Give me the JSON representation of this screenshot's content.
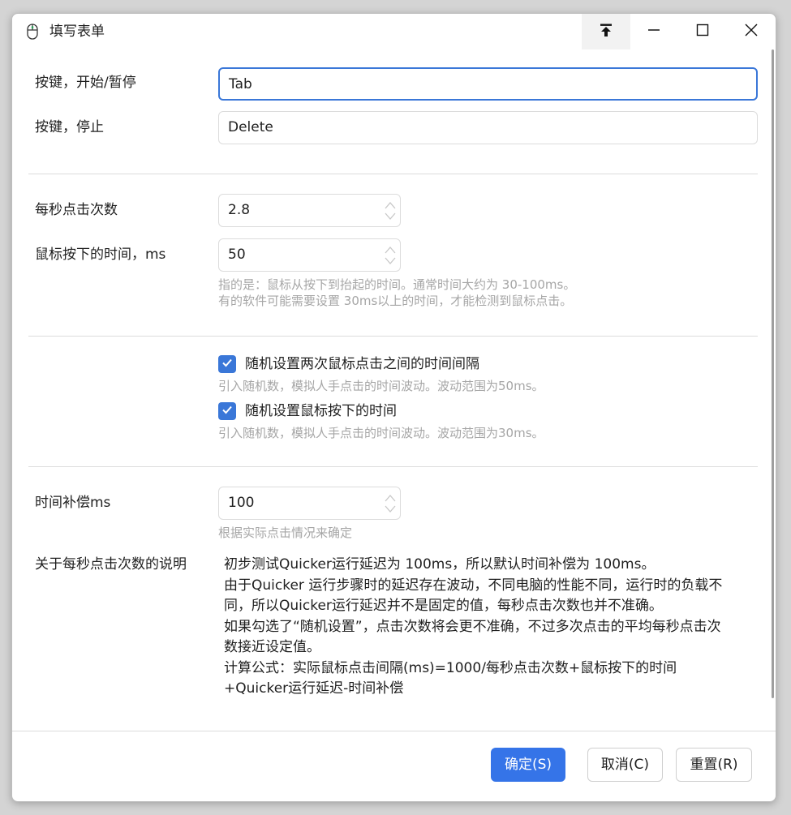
{
  "window": {
    "title": "填写表单"
  },
  "form": {
    "start_pause_key": {
      "label": "按键，开始/暂停",
      "value": "Tab"
    },
    "stop_key": {
      "label": "按键，停止",
      "value": "Delete"
    },
    "clicks_per_second": {
      "label": "每秒点击次数",
      "value": "2.8"
    },
    "press_duration": {
      "label": "鼠标按下的时间，ms",
      "value": "50",
      "hint_line1": "指的是：鼠标从按下到抬起的时间。通常时间大约为 30-100ms。",
      "hint_line2": "有的软件可能需要设置 30ms以上的时间，才能检测到鼠标点击。"
    },
    "random_interval": {
      "label": "随机设置两次鼠标点击之间的时间间隔",
      "checked": true,
      "hint": "引入随机数，模拟人手点击的时间波动。波动范围为50ms。"
    },
    "random_press": {
      "label": "随机设置鼠标按下的时间",
      "checked": true,
      "hint": "引入随机数，模拟人手点击的时间波动。波动范围为30ms。"
    },
    "time_compensation": {
      "label": "时间补偿ms",
      "value": "100",
      "hint": "根据实际点击情况来确定"
    },
    "description": {
      "label": "关于每秒点击次数的说明",
      "lines": [
        "初步测试Quicker运行延迟为 100ms，所以默认时间补偿为 100ms。",
        "由于Quicker 运行步骤时的延迟存在波动，不同电脑的性能不同，运行时的负载不",
        "同，所以Quicker运行延迟并不是固定的值，每秒点击次数也并不准确。",
        "如果勾选了“随机设置”，点击次数将会更不准确，不过多次点击的平均每秒点击次",
        "数接近设定值。",
        "计算公式：实际鼠标点击间隔(ms)=1000/每秒点击次数+鼠标按下的时间",
        "+Quicker运行延迟-时间补偿"
      ]
    }
  },
  "buttons": {
    "ok": "确定(S)",
    "cancel": "取消(C)",
    "reset": "重置(R)"
  },
  "colors": {
    "accent": "#3574e8",
    "focus_border": "#3a77d8",
    "hint_text": "#a6a6a6"
  },
  "icons": {
    "app": "mouse-icon",
    "pin": "pin-top-icon",
    "minimize": "minimize-icon",
    "maximize": "maximize-icon",
    "close": "close-icon",
    "check": "checkmark-icon"
  }
}
